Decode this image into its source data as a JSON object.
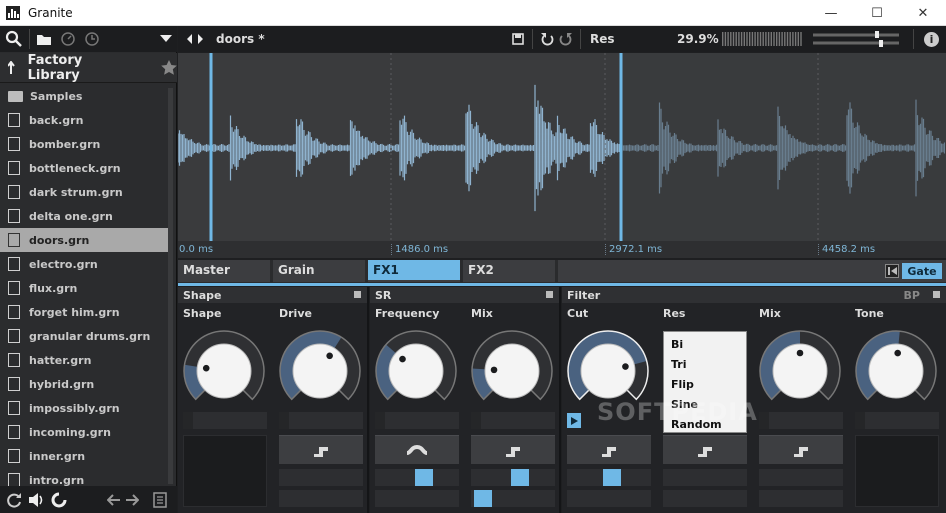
{
  "window": {
    "title": "Granite",
    "minimize": "—",
    "maximize": "☐",
    "close": "✕"
  },
  "sidebar": {
    "library_title": "Factory Library",
    "folder": "Samples",
    "files": [
      "back.grn",
      "bomber.grn",
      "bottleneck.grn",
      "dark strum.grn",
      "delta one.grn",
      "doors.grn",
      "electro.grn",
      "flux.grn",
      "forget him.grn",
      "granular drums.grn",
      "hatter.grn",
      "hybrid.grn",
      "impossibly.grn",
      "incoming.grn",
      "inner.grn",
      "intro.grn"
    ],
    "selected": "doors.grn"
  },
  "topbar": {
    "preset_name": "doors *",
    "res_label": "Res",
    "zoom": "29.9%",
    "info": "i"
  },
  "timeline": {
    "t0": "0.0 ms",
    "t1": "1486.0 ms",
    "t2": "2972.1 ms",
    "t3": "4458.2 ms"
  },
  "tabs": {
    "master": "Master",
    "grain": "Grain",
    "fx1": "FX1",
    "fx2": "FX2",
    "gate": "Gate"
  },
  "panels": {
    "shape": {
      "title": "Shape",
      "knobs": [
        "Shape",
        "Drive"
      ]
    },
    "sr": {
      "title": "SR",
      "knobs": [
        "Frequency",
        "Mix"
      ]
    },
    "filter": {
      "title": "Filter",
      "mode": "BP",
      "knobs": [
        "Cut",
        "Res",
        "Mix",
        "Tone"
      ]
    }
  },
  "dropdown": {
    "options": [
      "Bi",
      "Tri",
      "Flip",
      "Sine",
      "Random"
    ]
  },
  "watermark": "SOFTPEDIA",
  "colors": {
    "accent": "#6fb8e6",
    "background": "#1e1f21",
    "knob_arc": "#4a6280"
  },
  "knob_levels": {
    "shape": 0.2,
    "drive": 0.62,
    "frequency": 0.32,
    "sr_mix": 0.18,
    "cut": 0.78,
    "filter_mix": 0.5,
    "tone": 0.52
  },
  "mod_sliders": {
    "frequency": 0.6,
    "sr_mix_1": 0.6,
    "sr_mix_2": 0.05,
    "cut": 0.55
  }
}
